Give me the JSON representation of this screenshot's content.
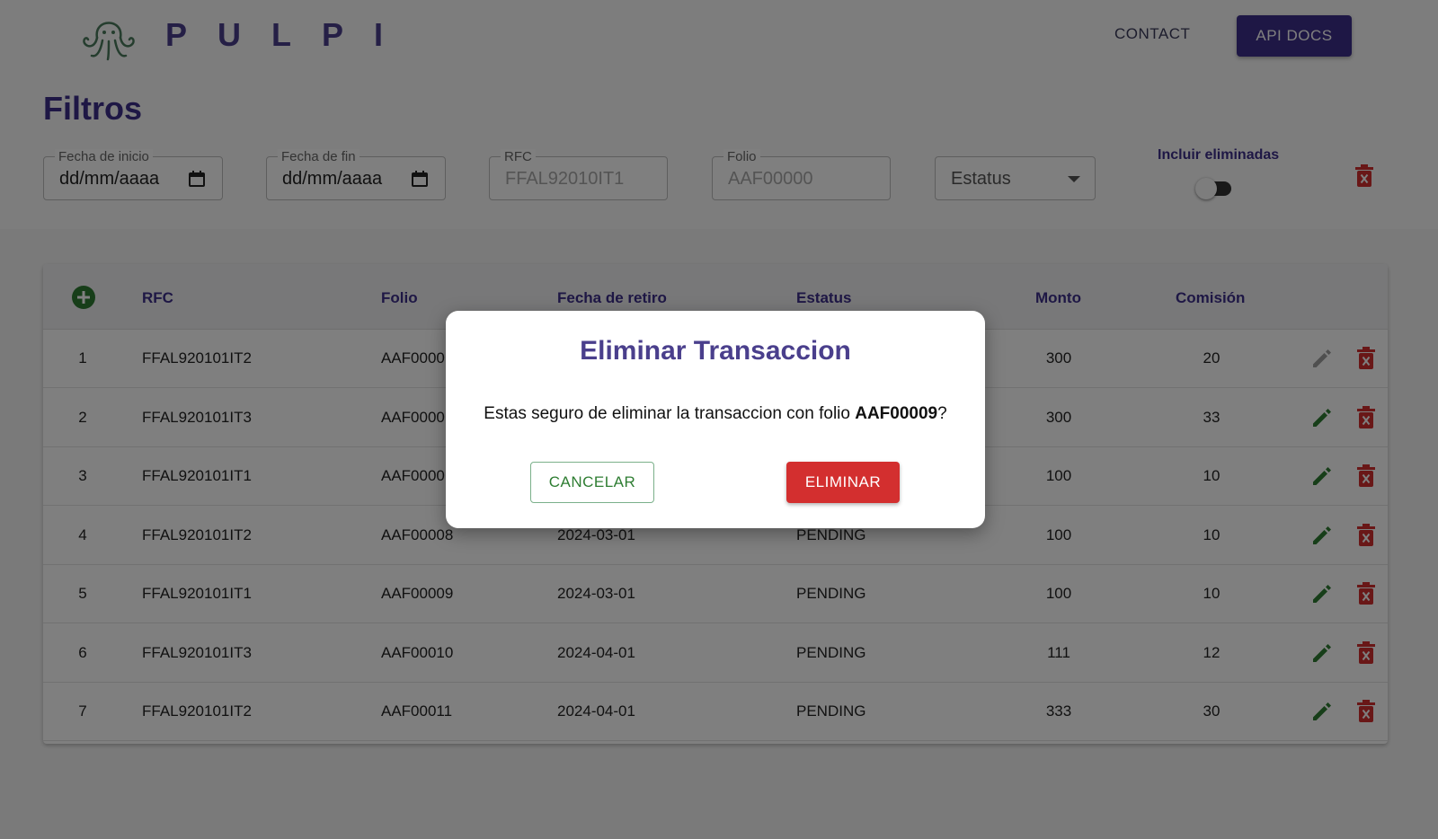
{
  "header": {
    "brand": "PULPI",
    "nav_contact": "CONTACT",
    "nav_api_docs": "API DOCS"
  },
  "filters": {
    "title": "Filtros",
    "start_date": {
      "label": "Fecha de inicio",
      "value": "dd/mm/aaaa"
    },
    "end_date": {
      "label": "Fecha de fin",
      "value": "dd/mm/aaaa"
    },
    "rfc": {
      "label": "RFC",
      "placeholder": "FFAL92010IT1"
    },
    "folio": {
      "label": "Folio",
      "placeholder": "AAF00000"
    },
    "status": {
      "value": "Estatus"
    },
    "include_deleted": {
      "label": "Incluir eliminadas",
      "checked": false
    }
  },
  "table": {
    "headers": {
      "rfc": "RFC",
      "folio": "Folio",
      "fecha": "Fecha de retiro",
      "estatus": "Estatus",
      "monto": "Monto",
      "comision": "Comisión"
    },
    "rows": [
      {
        "num": "1",
        "rfc": "FFAL920101IT2",
        "folio": "AAF0000",
        "fecha": "",
        "estatus": "",
        "monto": "300",
        "comision": "20",
        "editable": false
      },
      {
        "num": "2",
        "rfc": "FFAL920101IT3",
        "folio": "AAF0000",
        "fecha": "",
        "estatus": "",
        "monto": "300",
        "comision": "33",
        "editable": true
      },
      {
        "num": "3",
        "rfc": "FFAL920101IT1",
        "folio": "AAF0000",
        "fecha": "",
        "estatus": "",
        "monto": "100",
        "comision": "10",
        "editable": true
      },
      {
        "num": "4",
        "rfc": "FFAL920101IT2",
        "folio": "AAF00008",
        "fecha": "2024-03-01",
        "estatus": "PENDING",
        "monto": "100",
        "comision": "10",
        "editable": true
      },
      {
        "num": "5",
        "rfc": "FFAL920101IT1",
        "folio": "AAF00009",
        "fecha": "2024-03-01",
        "estatus": "PENDING",
        "monto": "100",
        "comision": "10",
        "editable": true
      },
      {
        "num": "6",
        "rfc": "FFAL920101IT3",
        "folio": "AAF00010",
        "fecha": "2024-04-01",
        "estatus": "PENDING",
        "monto": "111",
        "comision": "12",
        "editable": true
      },
      {
        "num": "7",
        "rfc": "FFAL920101IT2",
        "folio": "AAF00011",
        "fecha": "2024-04-01",
        "estatus": "PENDING",
        "monto": "333",
        "comision": "30",
        "editable": true
      }
    ]
  },
  "modal": {
    "title": "Eliminar Transaccion",
    "message_prefix": "Estas seguro de eliminar la transaccion con folio ",
    "folio": "AAF00009",
    "message_suffix": "?",
    "cancel_label": "CANCELAR",
    "delete_label": "ELIMINAR"
  },
  "colors": {
    "brand": "#3d2f8a",
    "edit_green": "#2e7d32",
    "delete_red": "#d32f2f"
  }
}
